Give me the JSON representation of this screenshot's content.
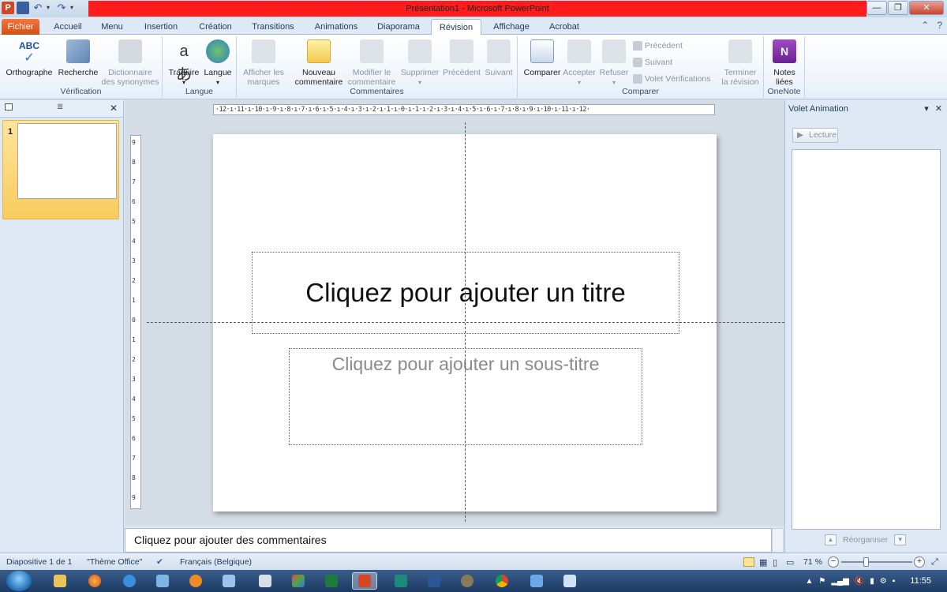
{
  "window": {
    "title": "Présentation1 - Microsoft PowerPoint",
    "app_icon_letter": "P",
    "title_bar_color": "#ff1c1c"
  },
  "tabs": [
    {
      "label": "Fichier",
      "active": false
    },
    {
      "label": "Accueil"
    },
    {
      "label": "Menu"
    },
    {
      "label": "Insertion"
    },
    {
      "label": "Création"
    },
    {
      "label": "Transitions"
    },
    {
      "label": "Animations"
    },
    {
      "label": "Diaporama"
    },
    {
      "label": "Révision",
      "active": true
    },
    {
      "label": "Affichage"
    },
    {
      "label": "Acrobat"
    }
  ],
  "ribbon": {
    "groups": {
      "verification": "Vérification",
      "langue": "Langue",
      "commentaires": "Commentaires",
      "comparer": "Comparer",
      "onenote": "OneNote"
    },
    "buttons": {
      "orthographe": "Orthographe",
      "recherche": "Recherche",
      "dictionnaire_1": "Dictionnaire",
      "dictionnaire_2": "des synonymes",
      "traduire": "Traduire",
      "langue": "Langue",
      "afficher_1": "Afficher les",
      "afficher_2": "marques",
      "nouveau_1": "Nouveau",
      "nouveau_2": "commentaire",
      "modifier_1": "Modifier le",
      "modifier_2": "commentaire",
      "supprimer": "Supprimer",
      "precedent": "Précédent",
      "suivant": "Suivant",
      "comparer": "Comparer",
      "accepter": "Accepter",
      "refuser": "Refuser",
      "precedent_small": "Précédent",
      "suivant_small": "Suivant",
      "volet_verifications": "Volet Vérifications",
      "terminer_1": "Terminer",
      "terminer_2": "la révision",
      "notes_1": "Notes",
      "notes_2": "liées"
    }
  },
  "slides_panel": {
    "slide_number": "1"
  },
  "ruler": {
    "horizontal": "·12·ı·11·ı·10·ı·9·ı·8·ı·7·ı·6·ı·5·ı·4·ı·3·ı·2·ı·1·ı·0·ı·1·ı·2·ı·3·ı·4·ı·5·ı·6·ı·7·ı·8·ı·9·ı·10·ı·11·ı·12·",
    "vertical": [
      "9",
      "8",
      "7",
      "6",
      "5",
      "4",
      "3",
      "2",
      "1",
      "0",
      "1",
      "2",
      "3",
      "4",
      "5",
      "6",
      "7",
      "8",
      "9"
    ]
  },
  "slide": {
    "title_placeholder": "Cliquez pour ajouter un titre",
    "subtitle_placeholder": "Cliquez pour ajouter un sous-titre"
  },
  "notes": {
    "placeholder": "Cliquez pour ajouter des commentaires"
  },
  "animation_pane": {
    "title": "Volet Animation",
    "play_label": "Lecture",
    "reorder_label": "Réorganiser"
  },
  "statusbar": {
    "slide_info": "Diapositive 1 de 1",
    "theme": "\"Thème Office\"",
    "language": "Français (Belgique)",
    "zoom": "71 %"
  },
  "taskbar": {
    "clock": "11:55"
  }
}
